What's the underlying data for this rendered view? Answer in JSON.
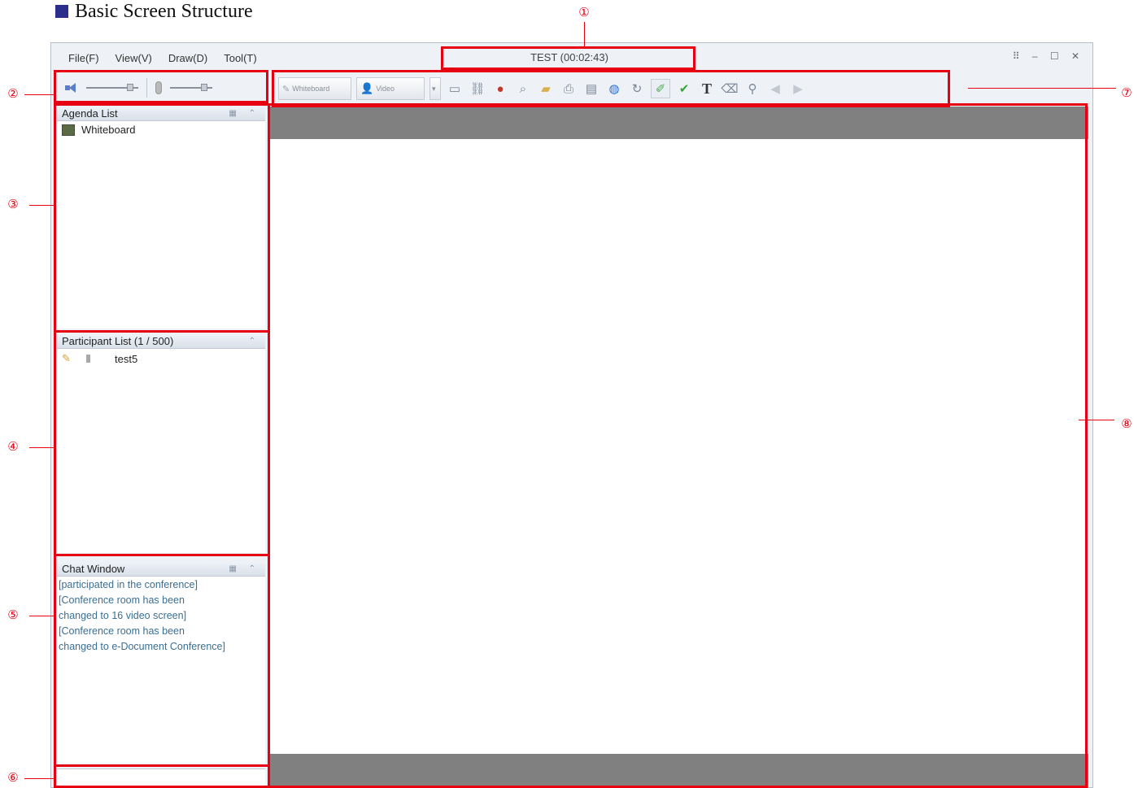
{
  "heading": "Basic Screen Structure",
  "menu": [
    "File(F)",
    "View(V)",
    "Draw(D)",
    "Tool(T)"
  ],
  "title": "TEST (00:02:43)",
  "window_controls": "⠿ – ☐ ✕",
  "toolbar": {
    "whiteboard_label": "Whiteboard",
    "video_label": "Video",
    "text_tool_label": "T"
  },
  "agenda": {
    "title": "Agenda List",
    "items": [
      "Whiteboard"
    ]
  },
  "participants": {
    "title": "Participant List (1 / 500)",
    "items": [
      "test5"
    ]
  },
  "chat": {
    "title": "Chat Window",
    "lines": [
      "[participated in the conference]",
      "[Conference room has been",
      "changed to 16 video screen]",
      "[Conference room has been",
      "changed to e-Document Conference]"
    ]
  },
  "callouts": [
    "①",
    "②",
    "③",
    "④",
    "⑤",
    "⑥",
    "⑦",
    "⑧"
  ],
  "colors": {
    "callout": "#e60012",
    "heading_bullet": "#2b2e8a",
    "whiteboard_bar": "#808080"
  }
}
